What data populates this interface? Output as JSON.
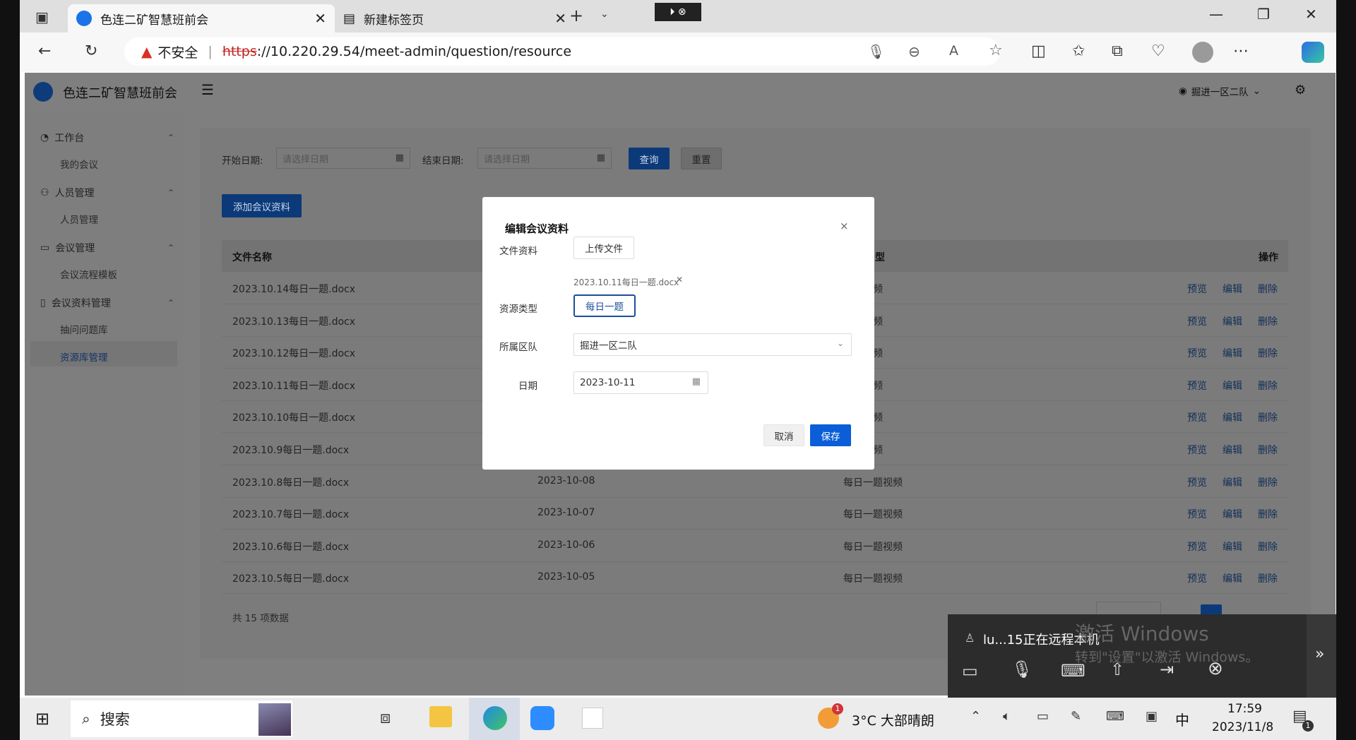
{
  "browser": {
    "tabs": [
      {
        "title": "色连二矿智慧班前会",
        "active": true
      },
      {
        "title": "新建标签页",
        "active": false
      }
    ],
    "recording_badge": "⏵ ⊗",
    "security_label": "不安全",
    "url_scheme": "https",
    "url_rest": "://10.220.29.54/meet-admin/question/resource"
  },
  "app": {
    "title": "色连二矿智慧班前会",
    "user": "掘进一区二队"
  },
  "sidebar": {
    "groups": [
      {
        "label": "工作台",
        "icon": "dashboard-icon",
        "items": [
          "我的会议"
        ]
      },
      {
        "label": "人员管理",
        "icon": "people-icon",
        "items": [
          "人员管理"
        ]
      },
      {
        "label": "会议管理",
        "icon": "monitor-icon",
        "items": [
          "会议流程模板"
        ]
      },
      {
        "label": "会议资料管理",
        "icon": "document-icon",
        "items": [
          "抽问问题库",
          "资源库管理"
        ]
      }
    ]
  },
  "filters": {
    "start_label": "开始日期:",
    "start_placeholder": "请选择日期",
    "end_label": "结束日期:",
    "end_placeholder": "请选择日期",
    "query": "查询",
    "reset": "重置"
  },
  "add_button": "添加会议资料",
  "table": {
    "headers": {
      "name": "文件名称",
      "type_partial": "型",
      "ops": "操作"
    },
    "rows": [
      {
        "name": "2023.10.14每日一题.docx",
        "date": "",
        "type": "一题视频"
      },
      {
        "name": "2023.10.13每日一题.docx",
        "date": "",
        "type": "一题视频"
      },
      {
        "name": "2023.10.12每日一题.docx",
        "date": "",
        "type": "一题视频"
      },
      {
        "name": "2023.10.11每日一题.docx",
        "date": "",
        "type": "一题视频"
      },
      {
        "name": "2023.10.10每日一题.docx",
        "date": "",
        "type": "一题视频"
      },
      {
        "name": "2023.10.9每日一题.docx",
        "date": "",
        "type": "一题视频"
      },
      {
        "name": "2023.10.8每日一题.docx",
        "date": "2023-10-08",
        "type": "每日一题视频"
      },
      {
        "name": "2023.10.7每日一题.docx",
        "date": "2023-10-07",
        "type": "每日一题视频"
      },
      {
        "name": "2023.10.6每日一题.docx",
        "date": "2023-10-06",
        "type": "每日一题视频"
      },
      {
        "name": "2023.10.5每日一题.docx",
        "date": "2023-10-05",
        "type": "每日一题视频"
      }
    ],
    "ops": [
      "预览",
      "编辑",
      "删除"
    ],
    "total": "共 15 项数据"
  },
  "modal": {
    "title": "编辑会议资料",
    "file_label": "文件资料",
    "upload_button": "上传文件",
    "uploaded_file": "2023.10.11每日一题.docx",
    "type_label": "资源类型",
    "type_value": "每日一题",
    "team_label": "所属区队",
    "team_value": "掘进一区二队",
    "date_label": "日期",
    "date_value": "2023-10-11",
    "cancel": "取消",
    "save": "保存"
  },
  "remote": {
    "user_text": "lu...15正在远程本机",
    "watermark_title": "激活 Windows",
    "watermark_sub": "转到\"设置\"以激活 Windows。"
  },
  "taskbar": {
    "search": "搜索",
    "weather": "3°C  大部晴朗",
    "weather_badge": "1",
    "ime": "中",
    "time": "17:59",
    "date": "2023/11/8",
    "notif_count": "1"
  }
}
